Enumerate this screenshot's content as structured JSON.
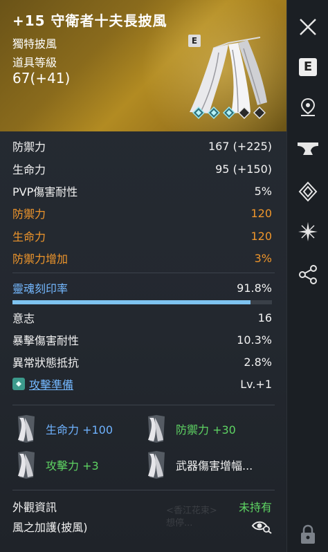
{
  "item": {
    "title": "+15 守衛者十夫長披風",
    "type": "獨特披風",
    "level_label": "道具等級",
    "level_value": "67(+41)",
    "grade": "E"
  },
  "stats": [
    {
      "label": "防禦力",
      "value": "167 (+225)",
      "color": "white"
    },
    {
      "label": "生命力",
      "value": "95 (+150)",
      "color": "white"
    },
    {
      "label": "PVP傷害耐性",
      "value": "5%",
      "color": "white"
    },
    {
      "label": "防禦力",
      "value": "120",
      "color": "orange"
    },
    {
      "label": "生命力",
      "value": "120",
      "color": "orange"
    },
    {
      "label": "防禦力增加",
      "value": "3%",
      "color": "orange"
    }
  ],
  "soul": {
    "label": "靈魂刻印率",
    "value": "91.8%",
    "fill": 0.918
  },
  "soul_stats": [
    {
      "label": "意志",
      "value": "16"
    },
    {
      "label": "暴擊傷害耐性",
      "value": "10.3%"
    },
    {
      "label": "異常狀態抵抗",
      "value": "2.8%"
    }
  ],
  "skill": {
    "label": "攻擊準備",
    "value": "Lv.+1"
  },
  "set_effects": [
    {
      "text": "生命力 +100",
      "color": "blue"
    },
    {
      "text": "防禦力 +30",
      "color": "green"
    },
    {
      "text": "攻擊力 +3",
      "color": "green"
    },
    {
      "text": "武器傷害增幅...",
      "color": "white"
    }
  ],
  "appearance": {
    "label": "外觀資訊",
    "status": "未持有",
    "name": "風之加護(披風)"
  },
  "ghost_text": [
    "<香江花束>",
    "想停..."
  ],
  "rail": {
    "grade": "E",
    "icons": [
      "close-icon",
      "grade-icon",
      "location-pin-icon",
      "anvil-icon",
      "soul-crystal-icon",
      "star-burst-icon",
      "share-icon",
      "lock-icon"
    ]
  },
  "colors": {
    "orange": "#f0962b",
    "blue": "#74b8ff",
    "green": "#5ed463",
    "gold_header": "#b28b22"
  }
}
